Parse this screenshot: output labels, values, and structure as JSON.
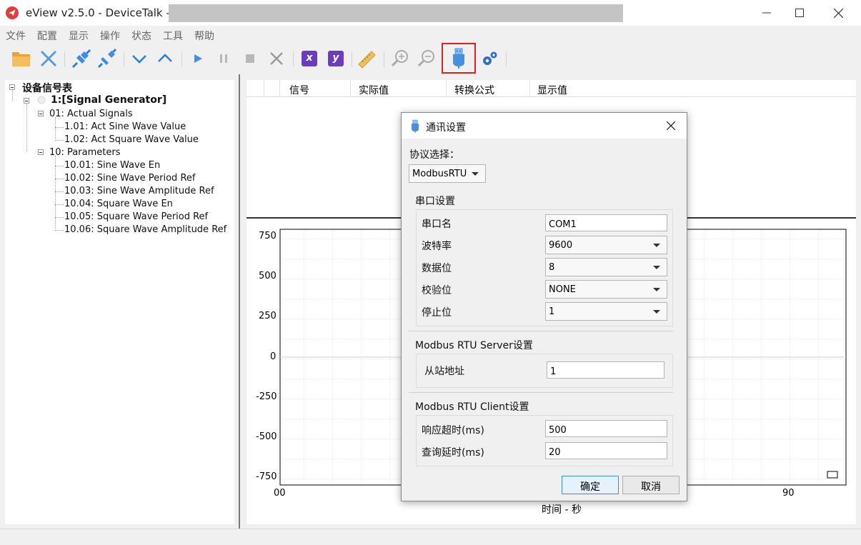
{
  "window": {
    "title": "eView v2.5.0 - DeviceTalk -"
  },
  "menu": [
    "文件",
    "配置",
    "显示",
    "操作",
    "状态",
    "工具",
    "帮助"
  ],
  "toolbar": {
    "icons": [
      "open-folder-icon",
      "disconnect-icon",
      "connect-icon",
      "disconnect-plug-icon",
      "chevron-down-icon",
      "chevron-up-icon",
      "play-icon",
      "pause-icon",
      "stop-icon",
      "clear-icon",
      "x-axis-icon",
      "y-axis-icon",
      "ruler-icon",
      "zoom-in-icon",
      "zoom-out-icon",
      "usb-icon",
      "settings-gears-icon"
    ],
    "x_label": "x",
    "y_label": "y",
    "highlight_color": "#e02020"
  },
  "tree": {
    "root": "设备信号表",
    "device": "1:[Signal Generator]",
    "groups": [
      {
        "label": "01: Actual Signals",
        "items": [
          "1.01: Act Sine Wave Value",
          "1.02: Act Square Wave Value"
        ]
      },
      {
        "label": "10: Parameters",
        "items": [
          "10.01: Sine Wave En",
          "10.02: Sine Wave Period Ref",
          "10.03: Sine Wave Amplitude Ref",
          "10.04: Square Wave En",
          "10.05: Square Wave Period Ref",
          "10.06: Square Wave Amplitude Ref"
        ]
      }
    ]
  },
  "table": {
    "columns": [
      "信号",
      "实际值",
      "转换公式",
      "显示值"
    ]
  },
  "chart": {
    "y_ticks": [
      "750",
      "500",
      "250",
      "0",
      "-250",
      "-500",
      "-750"
    ],
    "x_ticks": [
      "00",
      "90"
    ],
    "xlabel": "时间 - 秒"
  },
  "dialog": {
    "title": "通讯设置",
    "protocol_label": "协议选择：",
    "protocol_value": "ModbusRTU",
    "serial": {
      "title": "串口设置",
      "port_label": "串口名",
      "port_value": "COM1",
      "baud_label": "波特率",
      "baud_value": "9600",
      "databits_label": "数据位",
      "databits_value": "8",
      "parity_label": "校验位",
      "parity_value": "NONE",
      "stopbits_label": "停止位",
      "stopbits_value": "1"
    },
    "server": {
      "title": "Modbus RTU Server设置",
      "slave_label": "从站地址",
      "slave_value": "1"
    },
    "client": {
      "title": "Modbus RTU Client设置",
      "timeout_label": "响应超时(ms)",
      "timeout_value": "500",
      "delay_label": "查询延时(ms)",
      "delay_value": "20"
    },
    "ok_label": "确定",
    "cancel_label": "取消"
  }
}
